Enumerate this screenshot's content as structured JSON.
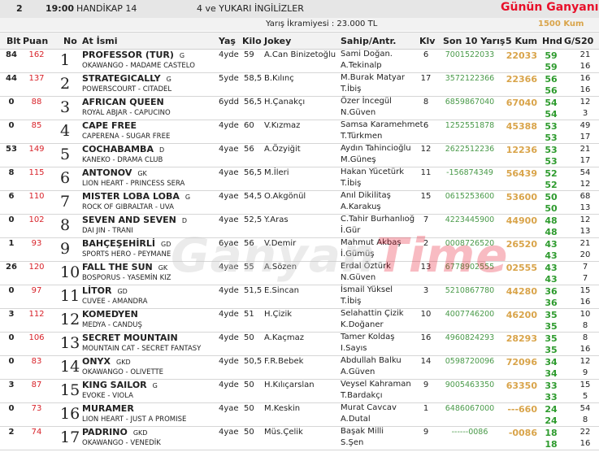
{
  "header": {
    "race_no": "2",
    "time": "19:00",
    "race_type": "HANDİKAP 14",
    "condition": "4 ve YUKARI İNGİLİZLER",
    "brand": "Günün Ganyanı",
    "prize": "Yarış İkramiyesi : 23.000 TL",
    "distance": "1500 Kum"
  },
  "columns": {
    "blt": "Blt",
    "puan": "Puan",
    "no": "No",
    "name": "At İsmi",
    "yas": "Yaş",
    "kilo": "Kilo",
    "jokey": "Jokey",
    "sahip": "Sahip/Antr.",
    "klv": "Klv",
    "son10": "Son 10 Yarış",
    "kum5": "5 Kum",
    "hnd": "Hnd",
    "gs20": "G/S20"
  },
  "watermark": {
    "a": "Ganyan",
    "b": "Time"
  },
  "rows": [
    {
      "blt": "84",
      "puan": "162",
      "no": "1",
      "name": "PROFESSOR (TUR)",
      "tag": "G",
      "ped": "OKAWANGO - MADAME CASTELO",
      "yas": "4yde",
      "kilo": "59",
      "jokey": "A.Can Binizetoğlu",
      "sahip": "Sami Doğan.",
      "antr": "A.Tekinalp",
      "klv": "6",
      "son10": "7001522033",
      "kum5": "22033",
      "hnd1": "59",
      "hnd2": "59",
      "g1": "21",
      "g2": "16"
    },
    {
      "blt": "44",
      "puan": "137",
      "no": "2",
      "name": "STRATEGICALLY",
      "tag": "G",
      "ped": "POWERSCOURT - CITADEL",
      "yas": "5yde",
      "kilo": "58,5",
      "jokey": "B.Kılınç",
      "sahip": "M.Burak Matyar",
      "antr": "T.İbiş",
      "klv": "17",
      "son10": "3572122366",
      "kum5": "22366",
      "hnd1": "56",
      "hnd2": "56",
      "g1": "16",
      "g2": "16"
    },
    {
      "blt": "0",
      "puan": "88",
      "no": "3",
      "name": "AFRICAN QUEEN",
      "tag": "",
      "ped": "ROYAL ABJAR - CAPUCINO",
      "yas": "6ydd",
      "kilo": "56,5",
      "jokey": "H.Çanakçı",
      "sahip": "Özer İncegül",
      "antr": "N.Güven",
      "klv": "8",
      "son10": "6859867040",
      "kum5": "67040",
      "hnd1": "54",
      "hnd2": "54",
      "g1": "12",
      "g2": "3"
    },
    {
      "blt": "0",
      "puan": "85",
      "no": "4",
      "name": "CAPE FREE",
      "tag": "",
      "ped": "CAPERENA - SUGAR FREE",
      "yas": "4yde",
      "kilo": "60",
      "jokey": "V.Kızmaz",
      "sahip": "Samsa Karamehmet",
      "antr": "T.Türkmen",
      "klv": "6",
      "son10": "1252551878",
      "kum5": "45388",
      "hnd1": "53",
      "hnd2": "53",
      "g1": "49",
      "g2": "17"
    },
    {
      "blt": "53",
      "puan": "149",
      "no": "5",
      "name": "COCHABAMBA",
      "tag": "D",
      "ped": "KANEKO - DRAMA CLUB",
      "yas": "4yae",
      "kilo": "56",
      "jokey": "A.Özyiğit",
      "sahip": "Aydın Tahincioğlu",
      "antr": "M.Güneş",
      "klv": "12",
      "son10": "2622512236",
      "kum5": "12236",
      "hnd1": "53",
      "hnd2": "53",
      "g1": "21",
      "g2": "17"
    },
    {
      "blt": "8",
      "puan": "115",
      "no": "6",
      "name": "ANTONOV",
      "tag": "GK",
      "ped": "LION HEART - PRINCESS SERA",
      "yas": "4yae",
      "kilo": "56,5",
      "jokey": "M.İleri",
      "sahip": "Hakan Yücetürk",
      "antr": "T.İbiş",
      "klv": "11",
      "son10": "-156874349",
      "kum5": "56439",
      "hnd1": "52",
      "hnd2": "52",
      "g1": "54",
      "g2": "12"
    },
    {
      "blt": "6",
      "puan": "110",
      "no": "7",
      "name": "MISTER LOBA LOBA",
      "tag": "G",
      "ped": "ROCK OF GIBRALTAR - UVA",
      "yas": "4yae",
      "kilo": "54,5",
      "jokey": "O.Akgönül",
      "sahip": "Anıl Dikilitaş",
      "antr": "A.Karakuş",
      "klv": "15",
      "son10": "0615253600",
      "kum5": "53600",
      "hnd1": "50",
      "hnd2": "50",
      "g1": "68",
      "g2": "13"
    },
    {
      "blt": "0",
      "puan": "102",
      "no": "8",
      "name": "SEVEN AND SEVEN",
      "tag": "D",
      "ped": "DAI JIN - TRANI",
      "yas": "4yae",
      "kilo": "52,5",
      "jokey": "Y.Aras",
      "sahip": "C.Tahir Burhanlıoğ",
      "antr": "İ.Gür",
      "klv": "7",
      "son10": "4223445900",
      "kum5": "44900",
      "hnd1": "48",
      "hnd2": "48",
      "g1": "12",
      "g2": "13"
    },
    {
      "blt": "1",
      "puan": "93",
      "no": "9",
      "name": "BAHÇEŞEHİRLİ",
      "tag": "GD",
      "ped": "SPORTS HERO - PEYMANE",
      "yas": "6yae",
      "kilo": "56",
      "jokey": "V.Demir",
      "sahip": "Mahmut Akbaş",
      "antr": "İ.Gümüş",
      "klv": "2",
      "son10": "0008726520",
      "kum5": "26520",
      "hnd1": "43",
      "hnd2": "43",
      "g1": "21",
      "g2": "20"
    },
    {
      "blt": "26",
      "puan": "120",
      "no": "10",
      "name": "FALL THE SUN",
      "tag": "GK",
      "ped": "BOSPORUS - YASEMİN KIZ",
      "yas": "4yae",
      "kilo": "55",
      "jokey": "A.Sözen",
      "sahip": "Erdal Öztürk",
      "antr": "N.Güven",
      "klv": "13",
      "son10": "6778902555",
      "kum5": "02555",
      "hnd1": "43",
      "hnd2": "43",
      "g1": "7",
      "g2": "7"
    },
    {
      "blt": "0",
      "puan": "97",
      "no": "11",
      "name": "LİTOR",
      "tag": "GD",
      "ped": "CUVEE - AMANDRA",
      "yas": "4yde",
      "kilo": "51,5",
      "jokey": "E.Sincan",
      "sahip": "İsmail Yüksel",
      "antr": "T.İbiş",
      "klv": "3",
      "son10": "5210867780",
      "kum5": "44280",
      "hnd1": "36",
      "hnd2": "36",
      "g1": "15",
      "g2": "16"
    },
    {
      "blt": "3",
      "puan": "112",
      "no": "12",
      "name": "KOMEDYEN",
      "tag": "",
      "ped": "MEDYA - CANDUŞ",
      "yas": "4yde",
      "kilo": "51",
      "jokey": "H.Çizik",
      "sahip": "Selahattin Çizik",
      "antr": "K.Doğaner",
      "klv": "10",
      "son10": "4007746200",
      "kum5": "46200",
      "hnd1": "35",
      "hnd2": "35",
      "g1": "10",
      "g2": "8"
    },
    {
      "blt": "0",
      "puan": "106",
      "no": "13",
      "name": "SECRET MOUNTAIN",
      "tag": "",
      "ped": "MOUNTAIN CAT - SECRET FANTASY",
      "yas": "4yde",
      "kilo": "50",
      "jokey": "A.Kaçmaz",
      "sahip": "Tamer Koldaş",
      "antr": "I.Sayıs",
      "klv": "16",
      "son10": "4960824293",
      "kum5": "28293",
      "hnd1": "35",
      "hnd2": "35",
      "g1": "8",
      "g2": "16"
    },
    {
      "blt": "0",
      "puan": "83",
      "no": "14",
      "name": "ONYX",
      "tag": "GKD",
      "ped": "OKAWANGO - OLIVETTE",
      "yas": "4yde",
      "kilo": "50,5",
      "jokey": "F.R.Bebek",
      "sahip": "Abdullah Balku",
      "antr": "A.Güven",
      "klv": "14",
      "son10": "0598720096",
      "kum5": "72096",
      "hnd1": "34",
      "hnd2": "34",
      "g1": "12",
      "g2": "9"
    },
    {
      "blt": "3",
      "puan": "87",
      "no": "15",
      "name": "KING SAILOR",
      "tag": "G",
      "ped": "EVOKE - VIOLA",
      "yas": "4yde",
      "kilo": "50",
      "jokey": "H.Kılıçarslan",
      "sahip": "Veysel Kahraman",
      "antr": "T.Bardakçı",
      "klv": "9",
      "son10": "9005463350",
      "kum5": "63350",
      "hnd1": "33",
      "hnd2": "33",
      "g1": "15",
      "g2": "5"
    },
    {
      "blt": "0",
      "puan": "73",
      "no": "16",
      "name": "MURAMER",
      "tag": "",
      "ped": "LION HEART - JUST A PROMISE",
      "yas": "4yae",
      "kilo": "50",
      "jokey": "M.Keskin",
      "sahip": "Murat Cavcav",
      "antr": "A.Dutal",
      "klv": "1",
      "son10": "6486067000",
      "kum5": "---660",
      "hnd1": "24",
      "hnd2": "24",
      "g1": "54",
      "g2": "8"
    },
    {
      "blt": "2",
      "puan": "74",
      "no": "17",
      "name": "PADRINO",
      "tag": "GKD",
      "ped": "OKAWANGO - VENEDİK",
      "yas": "4yae",
      "kilo": "50",
      "jokey": "Müs.Çelik",
      "sahip": "Başak Milli",
      "antr": "S.Şen",
      "klv": "9",
      "son10": "------0086",
      "kum5": "-0086",
      "hnd1": "18",
      "hnd2": "18",
      "g1": "22",
      "g2": "16"
    }
  ]
}
